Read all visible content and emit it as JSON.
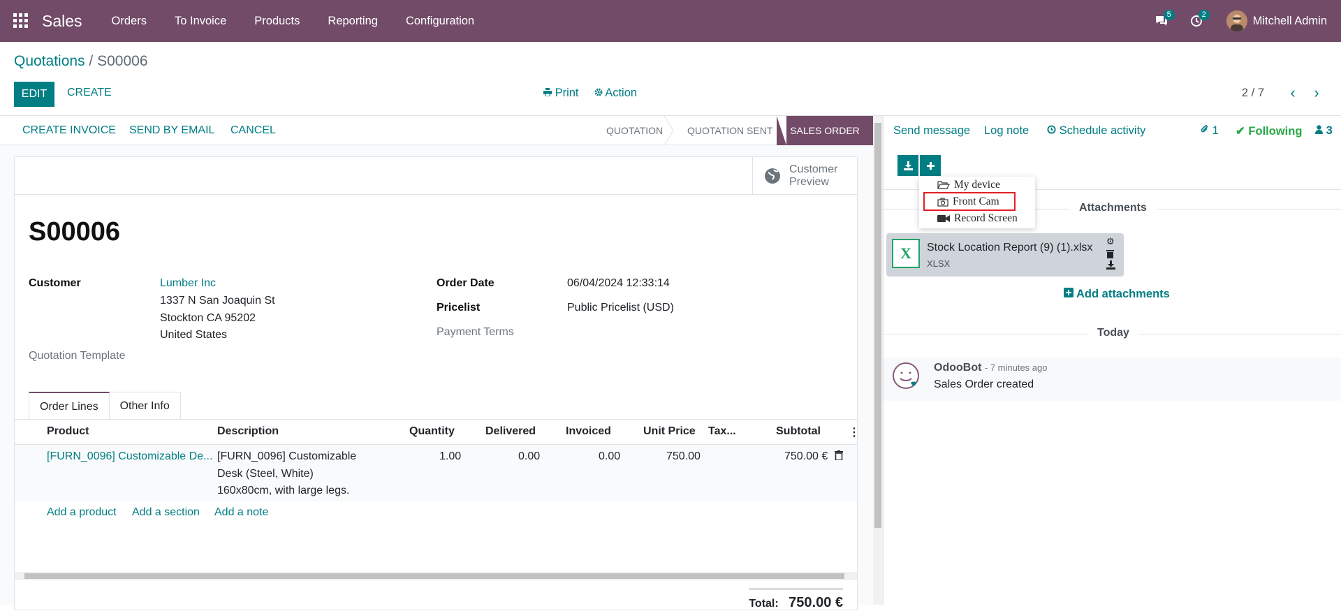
{
  "nav": {
    "app": "Sales",
    "menus": [
      "Orders",
      "To Invoice",
      "Products",
      "Reporting",
      "Configuration"
    ],
    "messages_count": "5",
    "activities_count": "2",
    "user": "Mitchell Admin"
  },
  "cp": {
    "breadcrumb_parent": "Quotations",
    "breadcrumb_sep": "/",
    "breadcrumb_current": "S00006",
    "edit": "EDIT",
    "create": "CREATE",
    "print": "Print",
    "action": "Action",
    "pager": "2 / 7"
  },
  "statusbar": {
    "create_invoice": "CREATE INVOICE",
    "send_email": "SEND BY EMAIL",
    "cancel": "CANCEL",
    "stages": [
      "QUOTATION",
      "QUOTATION SENT",
      "SALES ORDER"
    ]
  },
  "form": {
    "preview_line1": "Customer",
    "preview_line2": "Preview",
    "name": "S00006",
    "customer_label": "Customer",
    "customer_name": "Lumber Inc",
    "address1": "1337 N San Joaquin St",
    "address2": "Stockton CA 95202",
    "address3": "United States",
    "template_label": "Quotation Template",
    "order_date_label": "Order Date",
    "order_date": "06/04/2024 12:33:14",
    "pricelist_label": "Pricelist",
    "pricelist": "Public Pricelist (USD)",
    "payment_terms_label": "Payment Terms",
    "tabs": [
      "Order Lines",
      "Other Info"
    ],
    "columns": [
      "Product",
      "Description",
      "Quantity",
      "Delivered",
      "Invoiced",
      "Unit Price",
      "Tax...",
      "Subtotal"
    ],
    "line": {
      "product": "[FURN_0096] Customizable De...",
      "desc1": "[FURN_0096] Customizable",
      "desc2": "Desk (Steel, White)",
      "desc3": "160x80cm, with large legs.",
      "quantity": "1.00",
      "delivered": "0.00",
      "invoiced": "0.00",
      "unit_price": "750.00",
      "subtotal": "750.00 €"
    },
    "add_product": "Add a product",
    "add_section": "Add a section",
    "add_note": "Add a note",
    "total_label": "Total:",
    "total_value": "750.00 €"
  },
  "chatter": {
    "send_message": "Send message",
    "log_note": "Log note",
    "schedule": "Schedule activity",
    "attachments_count": "1",
    "following": "Following",
    "followers_count": "3",
    "dropdown": [
      "My device",
      "Front Cam",
      "Record Screen"
    ],
    "attachments_title": "Attachments",
    "file_name": "Stock Location Report (9) (1).xlsx",
    "file_ext": "XLSX",
    "add_attachments": "Add attachments",
    "today": "Today",
    "author": "OdooBot",
    "ago": "- 7 minutes ago",
    "message": "Sales Order created"
  },
  "colors": {
    "primary": "#714B67",
    "accent": "#017E84",
    "highlight_box": "#e41e26"
  }
}
